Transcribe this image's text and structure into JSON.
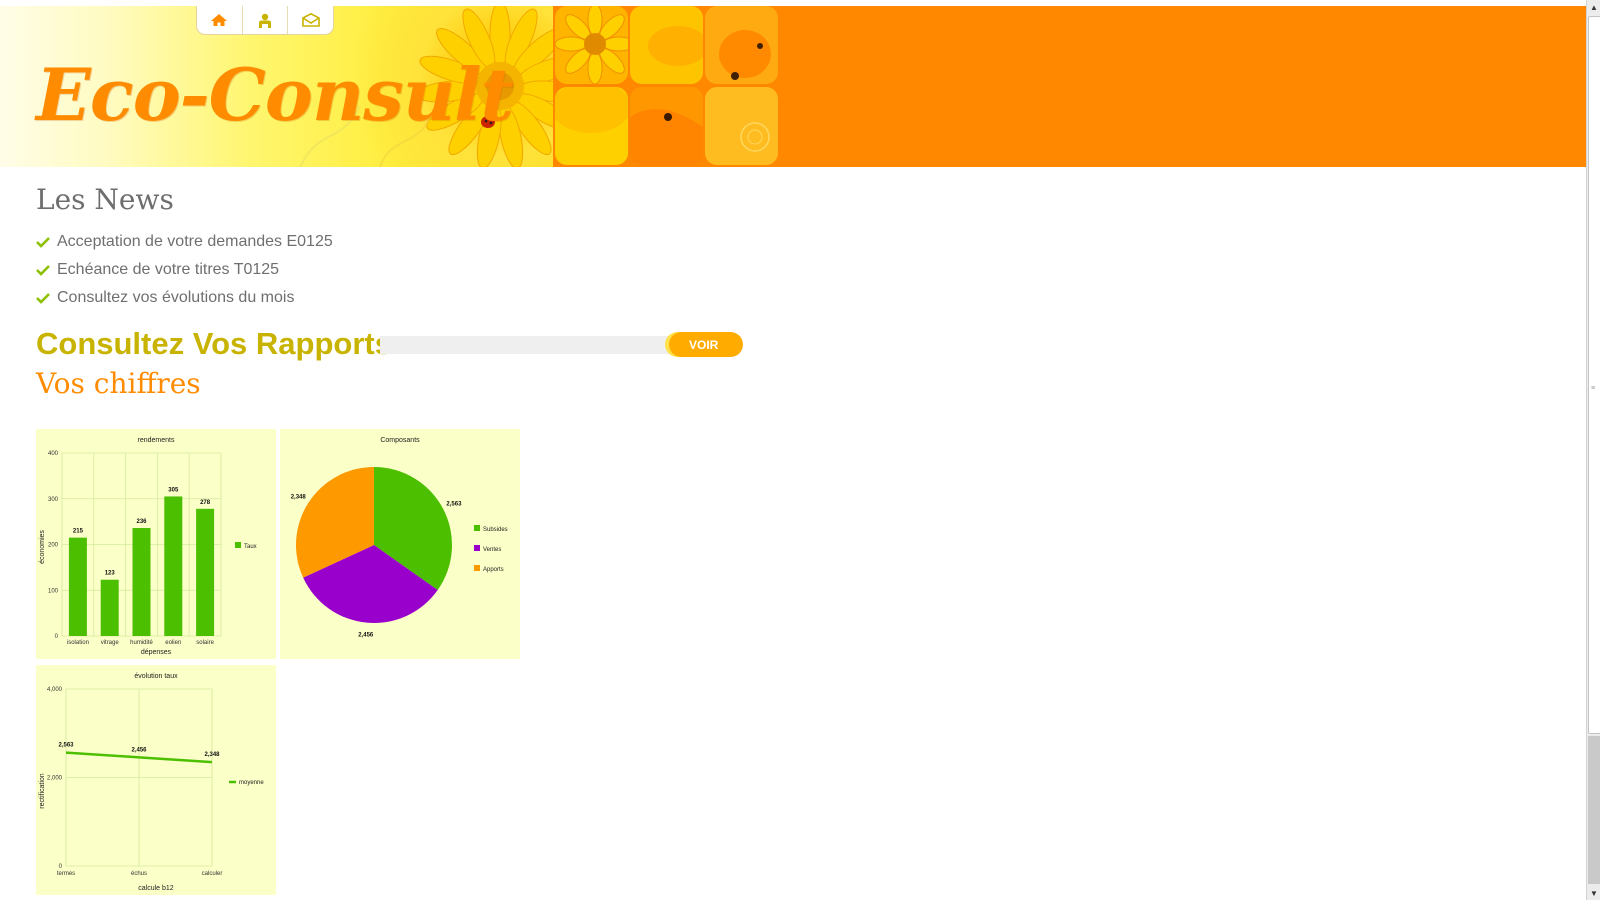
{
  "header": {
    "logo": "Eco-Consult",
    "nav": [
      {
        "name": "home-icon",
        "label": "Accueil"
      },
      {
        "name": "user-icon",
        "label": "Profil"
      },
      {
        "name": "mail-icon",
        "label": "Contact"
      }
    ],
    "colors": {
      "brand": "#ff8800",
      "logo": "#ff8c00"
    }
  },
  "news": {
    "title": "Les News",
    "items": [
      "Acceptation de votre demandes E0125",
      "Echéance de votre titres T0125",
      "Consultez vos évolutions du mois"
    ]
  },
  "rapports": {
    "title": "Consultez Vos Rapports",
    "input_value": "",
    "button_label": "VOIR"
  },
  "chiffres": {
    "title": "Vos chiffres"
  },
  "chart_data": [
    {
      "type": "bar",
      "title": "rendements",
      "categories": [
        "isolation",
        "vitrage",
        "humidité",
        "eolien",
        "solaire"
      ],
      "series": [
        {
          "name": "Taux",
          "values": [
            215,
            123,
            236,
            305,
            278
          ],
          "color": "#4cbf00"
        }
      ],
      "xlabel": "dépenses",
      "ylabel": "économies",
      "ylim": [
        0,
        400
      ],
      "yticks": [
        "0",
        "100",
        "200",
        "300",
        "400"
      ],
      "grid": true,
      "legend": "right"
    },
    {
      "type": "pie",
      "title": "Composants",
      "labels": [
        "Subsides",
        "Ventes",
        "Apports"
      ],
      "values": [
        2563,
        2456,
        2348
      ],
      "value_labels": [
        "2,563",
        "2,456",
        "2,348"
      ],
      "colors": [
        "#4cbf00",
        "#9900cc",
        "#ff9900"
      ],
      "legend": "right"
    },
    {
      "type": "line",
      "title": "évolution taux",
      "categories": [
        "termes",
        "échus",
        "calculer"
      ],
      "series": [
        {
          "name": "moyenne",
          "values": [
            2563,
            2456,
            2348
          ],
          "color": "#4cbf00"
        }
      ],
      "value_labels": [
        "2,563",
        "2,456",
        "2,348"
      ],
      "xlabel": "calcule b12",
      "ylabel": "rectification",
      "ylim": [
        0,
        4000
      ],
      "yticks": [
        "0",
        "2,000",
        "4,000"
      ],
      "grid": true,
      "legend": "right"
    }
  ]
}
